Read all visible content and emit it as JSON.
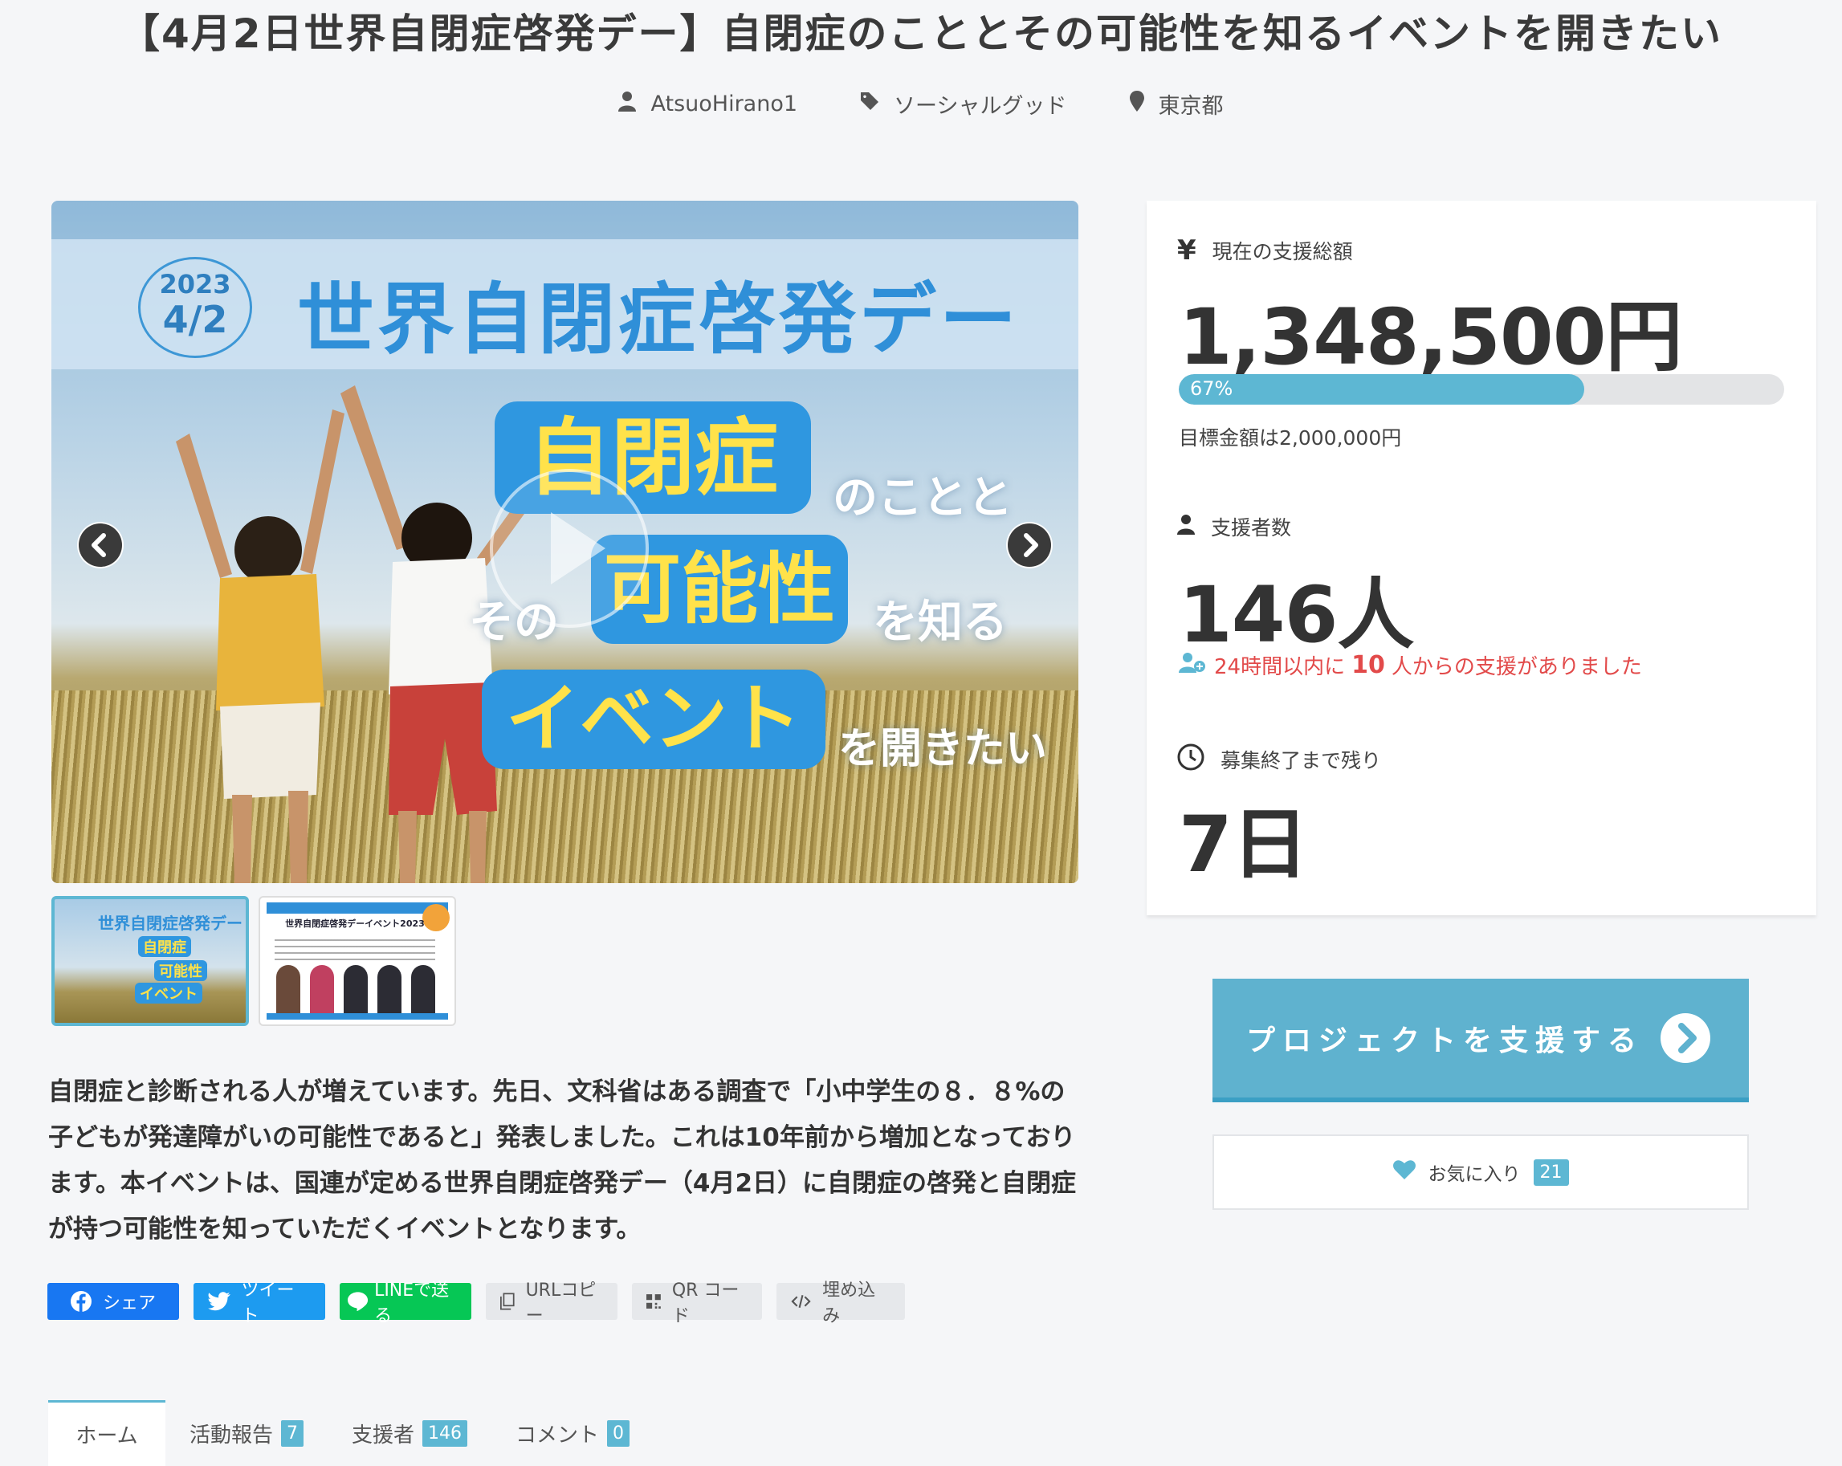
{
  "title": "【4月2日世界自閉症啓発デー】自閉症のこととその可能性を知るイベントを開きたい",
  "meta": {
    "author": "AtsuoHirano1",
    "category": "ソーシャルグッド",
    "location": "東京都"
  },
  "hero": {
    "year": "2023",
    "date": "4/2",
    "headline": "世界自閉症啓発デー",
    "pill1": "自閉症",
    "side1": "のことと",
    "side2": "その",
    "pill2": "可能性",
    "side3": "を知る",
    "pill3": "イベント",
    "side4": "を開きたい"
  },
  "thumbnails": {
    "t1_title": "世界自閉症啓発デー",
    "t1_pill1": "自閉症",
    "t1_pill2": "可能性",
    "t1_pill3": "イベント",
    "t2_title": "世界自閉症啓発デーイベント2023"
  },
  "description": "自閉症と診断される人が増えています。先日、文科省はある調査で「小中学生の８．８%の子どもが発達障がいの可能性であると」発表しました。これは10年前から増加となっております。本イベントは、国連が定める世界自閉症啓発デー（4月2日）に自閉症の啓発と自閉症が持つ可能性を知っていただくイベントとなります。",
  "share": {
    "facebook": "シェア",
    "twitter": "ツイート",
    "line": "LINEで送る",
    "url_copy": "URLコピー",
    "qr": "QR コード",
    "embed": "埋め込み"
  },
  "tabs": [
    {
      "label": "ホーム"
    },
    {
      "label": "活動報告",
      "count": "7"
    },
    {
      "label": "支援者",
      "count": "146"
    },
    {
      "label": "コメント",
      "count": "0"
    }
  ],
  "stats": {
    "total_label": "現在の支援総額",
    "total_value": "1,348,500円",
    "progress_text": "67%",
    "progress": 0.67,
    "goal_text": "目標金額は2,000,000円",
    "backers_label": "支援者数",
    "backers_value": "146人",
    "recent_prefix": "24時間以内に",
    "recent_count": "10",
    "recent_suffix": "人からの支援がありました",
    "remaining_label": "募集終了まで残り",
    "remaining_value": "7日"
  },
  "actions": {
    "support_label": "プロジェクトを支援する",
    "favorite_label": "お気に入り",
    "favorite_count": "21"
  },
  "colors": {
    "accent": "#5db7d3",
    "alert": "#e24a4a",
    "facebook": "#1877f2",
    "twitter": "#1d9bf0",
    "line": "#06c755"
  }
}
